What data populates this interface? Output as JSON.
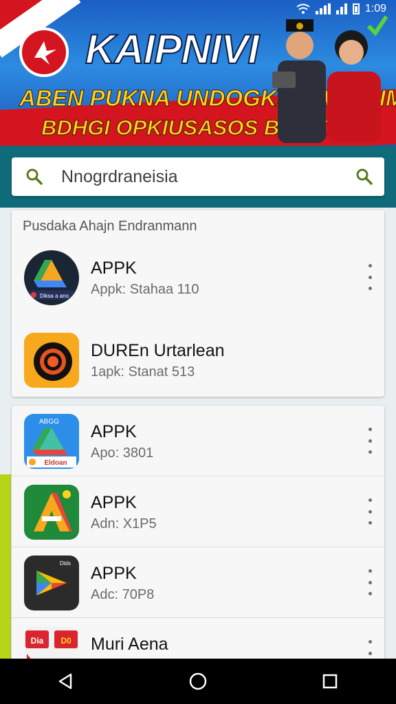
{
  "status_bar": {
    "time": "1:09",
    "icons": [
      "wifi-icon",
      "signal-icon",
      "battery-icon"
    ]
  },
  "banner": {
    "title": "KAIPNIVI",
    "line1": "ABEN PUKNA UNDOGKAN APOSIM",
    "line2": "BDHGI OPKIUSASOS BAMKAI!",
    "logo_icon": "star-logo-icon",
    "colors": {
      "blue": "#1a5fc4",
      "red": "#d4151f",
      "yellow": "#ffd21c"
    }
  },
  "search": {
    "value": "Nnogrdraneisia",
    "placeholder": "Nnogrdraneisia",
    "strip_color": "#0f6b79"
  },
  "section1": {
    "title": "Pusdaka Ahajn Endranmann",
    "items": [
      {
        "name": "APPK",
        "sub": "Appk: Stahaa 110",
        "icon": "drive-triangle-icon",
        "badge": "Diksa a ano"
      },
      {
        "name": "DUREn Urtarlean",
        "sub": "1apk: Stanat 513",
        "icon": "orange-target-icon"
      }
    ]
  },
  "section2": {
    "items": [
      {
        "name": "APPK",
        "sub": "Apo: 3801",
        "icon": "blue-drive-icon",
        "badge": "Eldoan",
        "corner": "ABGG"
      },
      {
        "name": "APPK",
        "sub": "Adn: X1P5",
        "icon": "green-a-icon"
      },
      {
        "name": "APPK",
        "sub": "Adc: 70P8",
        "icon": "play-triangle-icon",
        "corner": "Dids"
      },
      {
        "name": "Muri Aena",
        "sub": "",
        "icon": "red-tiles-icon",
        "badge": "Dia",
        "badge2": "D0"
      }
    ]
  },
  "nav": {
    "buttons": [
      "back-icon",
      "home-icon",
      "recents-icon"
    ]
  }
}
